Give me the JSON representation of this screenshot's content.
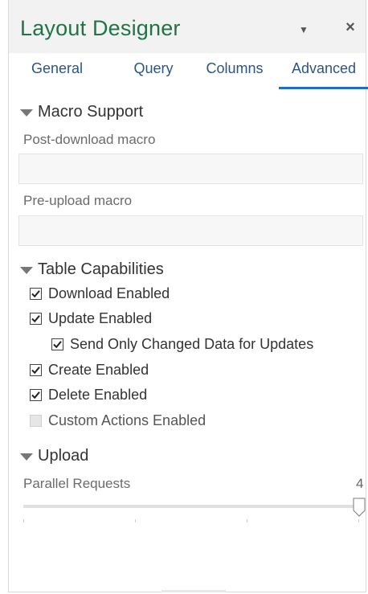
{
  "panel": {
    "title": "Layout Designer",
    "dropdown_icon": "caret-down",
    "close_label": "×"
  },
  "tabs": [
    {
      "label": "General",
      "active": false
    },
    {
      "label": "Query",
      "active": false
    },
    {
      "label": "Columns",
      "active": false
    },
    {
      "label": "Advanced",
      "active": true
    }
  ],
  "macro": {
    "header": "Macro Support",
    "post_download_label": "Post-download macro",
    "post_download_value": "",
    "pre_upload_label": "Pre-upload macro",
    "pre_upload_value": ""
  },
  "table": {
    "header": "Table Capabilities",
    "items": [
      {
        "label": "Download Enabled",
        "checked": true,
        "disabled": false
      },
      {
        "label": "Update Enabled",
        "checked": true,
        "disabled": false
      },
      {
        "label": "Send Only Changed Data for Updates",
        "checked": true,
        "disabled": false
      },
      {
        "label": "Create Enabled",
        "checked": true,
        "disabled": false
      },
      {
        "label": "Delete Enabled",
        "checked": true,
        "disabled": false
      },
      {
        "label": "Custom Actions Enabled",
        "checked": false,
        "disabled": true
      }
    ]
  },
  "upload": {
    "header": "Upload",
    "parallel_label": "Parallel Requests",
    "parallel_value": "4",
    "slider_fraction": 1.0
  },
  "colors": {
    "title": "#217346",
    "tab_text": "#2a5585",
    "tab_underline": "#1f6fbf"
  }
}
